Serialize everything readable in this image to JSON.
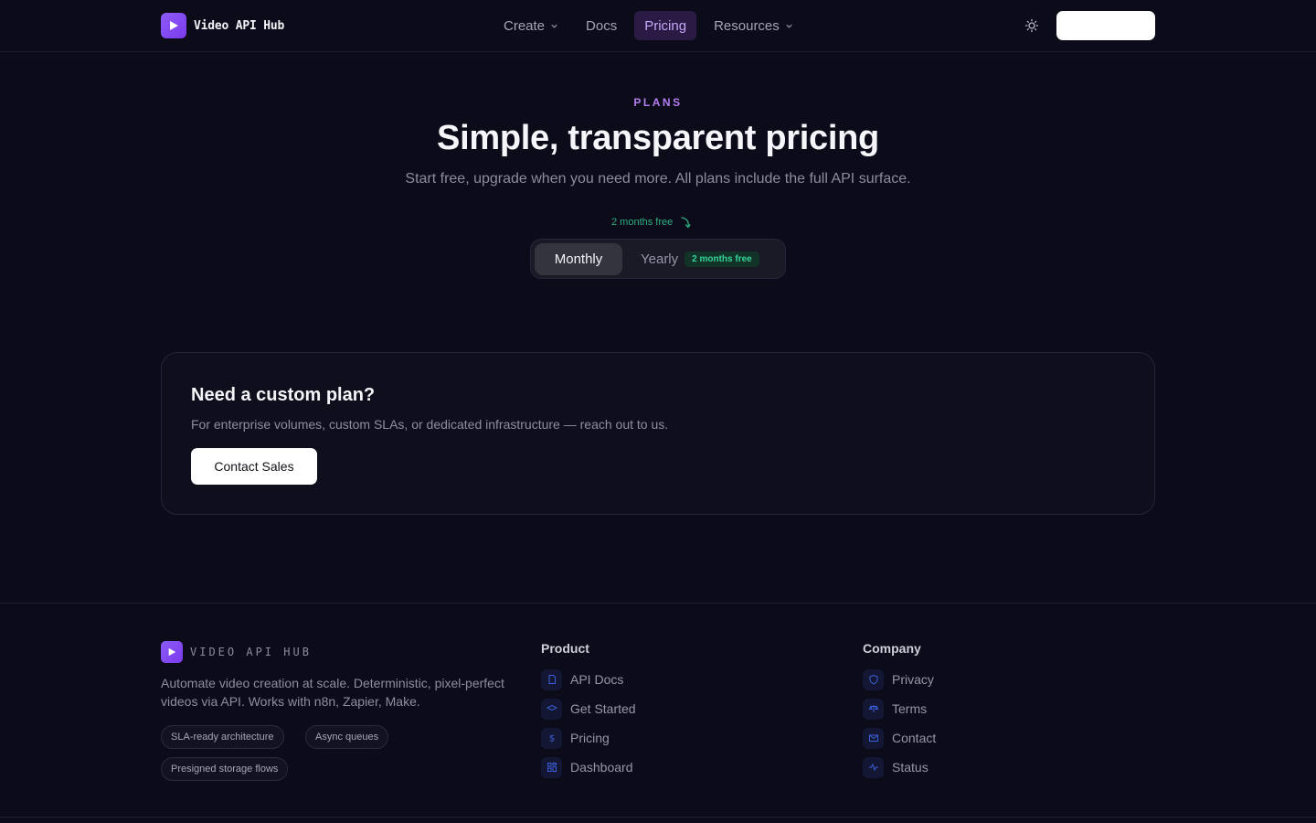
{
  "header": {
    "brand_name": "Video API Hub",
    "nav": [
      {
        "label": "Create",
        "dropdown": true
      },
      {
        "label": "Docs",
        "dropdown": false
      },
      {
        "label": "Pricing",
        "dropdown": false,
        "active": true
      },
      {
        "label": "Resources",
        "dropdown": true
      }
    ],
    "theme_icon": "sun-icon"
  },
  "hero": {
    "eyebrow": "PLANS",
    "title": "Simple, transparent pricing",
    "subtitle": "Start free, upgrade when you need more. All plans include the full API surface.",
    "promo_hint": "2 months free"
  },
  "billing_toggle": {
    "monthly_label": "Monthly",
    "yearly_label": "Yearly",
    "yearly_badge": "2 months free",
    "selected": "Monthly"
  },
  "custom_plan": {
    "title": "Need a custom plan?",
    "description": "For enterprise volumes, custom SLAs, or dedicated infrastructure — reach out to us.",
    "button_label": "Contact Sales"
  },
  "footer": {
    "brand_name": "VIDEO API HUB",
    "description": "Automate video creation at scale. Deterministic, pixel-perfect videos via API. Works with n8n, Zapier, Make.",
    "chips": [
      "SLA-ready architecture",
      "Async queues",
      "Presigned storage flows"
    ],
    "product": {
      "title": "Product",
      "links": [
        {
          "label": "API Docs",
          "icon": "file-icon"
        },
        {
          "label": "Get Started",
          "icon": "graduation-cap-icon"
        },
        {
          "label": "Pricing",
          "icon": "dollar-icon"
        },
        {
          "label": "Dashboard",
          "icon": "dashboard-icon"
        }
      ]
    },
    "company": {
      "title": "Company",
      "links": [
        {
          "label": "Privacy",
          "icon": "shield-icon"
        },
        {
          "label": "Terms",
          "icon": "scale-icon"
        },
        {
          "label": "Contact",
          "icon": "mail-icon"
        },
        {
          "label": "Status",
          "icon": "activity-icon"
        }
      ]
    }
  },
  "colors": {
    "background": "#0b0b19",
    "accent": "#7c3aed",
    "accent_text": "#b57ef0",
    "success": "#36d39a"
  }
}
